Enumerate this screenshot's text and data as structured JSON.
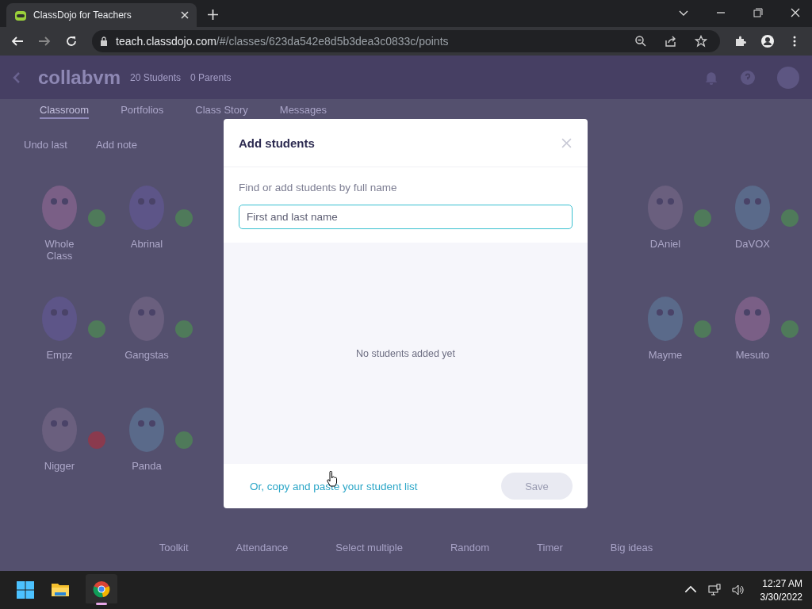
{
  "browser": {
    "tab_title": "ClassDojo for Teachers",
    "url_host": "teach.classdojo.com",
    "url_path": "/#/classes/623da542e8d5b3dea3c0833c/points"
  },
  "header": {
    "class_name": "collabvm",
    "students_count": "20 Students",
    "parents_count": "0 Parents"
  },
  "tabs": [
    {
      "label": "Classroom",
      "selected": true
    },
    {
      "label": "Portfolios",
      "selected": false
    },
    {
      "label": "Class Story",
      "selected": false
    },
    {
      "label": "Messages",
      "selected": false
    }
  ],
  "actions": [
    "Undo last",
    "Add note"
  ],
  "student_rows": [
    {
      "left": [
        {
          "name": "Whole Class",
          "color": "#4f7a5a"
        },
        {
          "name": "Abrinal",
          "color": "#4f7a5a"
        }
      ],
      "right": [
        {
          "name": "DAniel",
          "color": "#4f7a5a"
        },
        {
          "name": "DaVOX",
          "color": "#4f7a5a"
        }
      ]
    },
    {
      "left": [
        {
          "name": "Empz",
          "color": "#4f7a5a"
        },
        {
          "name": "Gangstas",
          "color": "#4f7a5a"
        }
      ],
      "right": [
        {
          "name": "Mayme",
          "color": "#4f7a5a"
        },
        {
          "name": "Mesuto",
          "color": "#4f7a5a"
        }
      ]
    },
    {
      "left": [
        {
          "name": "Nigger",
          "color": "#8a3a4e"
        },
        {
          "name": "Panda",
          "color": "#4f7a5a"
        }
      ],
      "right": []
    }
  ],
  "bottom_tools": [
    "Toolkit",
    "Attendance",
    "Select multiple",
    "Random",
    "Timer",
    "Big ideas"
  ],
  "modal": {
    "title": "Add students",
    "field_label": "Find or add students by full name",
    "placeholder": "First and last name",
    "empty_text": "No students added yet",
    "paste_link": "Or, copy and paste your student list",
    "save_button": {
      "label": "Save",
      "disabled": true
    }
  },
  "taskbar": {
    "time": "12:27 AM",
    "date": "3/30/2022"
  }
}
